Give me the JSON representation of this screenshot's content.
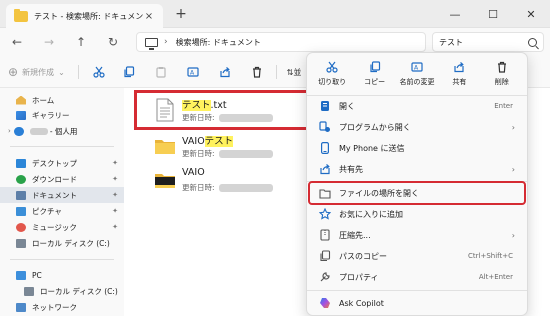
{
  "window": {
    "tab_title": "テスト - 検索場所: ドキュメント",
    "tab_close": "×",
    "new_tab": "+",
    "minimize": "—",
    "maximize": "☐",
    "close": "✕"
  },
  "nav": {
    "back": "←",
    "forward": "→",
    "up": "↑",
    "refresh": "↻",
    "address_chevron": "›",
    "address_text": "検索場所: ドキュメント",
    "search_value": "テスト"
  },
  "toolbar": {
    "new_label": "新規作成",
    "new_chevron": "⌄",
    "sort_partial": "並"
  },
  "sidebar": {
    "items": [
      {
        "label": "ホーム",
        "icon": "home-icon"
      },
      {
        "label": "ギャラリー",
        "icon": "gallery-icon"
      },
      {
        "label": "- 個人用",
        "icon": "onedrive-icon"
      },
      {
        "label": "デスクトップ",
        "icon": "desktop-icon"
      },
      {
        "label": "ダウンロード",
        "icon": "download-icon"
      },
      {
        "label": "ドキュメント",
        "icon": "documents-icon"
      },
      {
        "label": "ピクチャ",
        "icon": "pictures-icon"
      },
      {
        "label": "ミュージック",
        "icon": "music-icon"
      },
      {
        "label": "ローカル ディスク (C:)",
        "icon": "drive-icon"
      },
      {
        "label": "PC",
        "icon": "pc-icon"
      },
      {
        "label": "ローカル ディスク (C:)",
        "icon": "drive-icon"
      },
      {
        "label": "ネットワーク",
        "icon": "network-icon"
      }
    ],
    "pin_glyph": "📌"
  },
  "files": [
    {
      "name_hl": "テスト",
      "name_rest": ".txt",
      "name_pre": "",
      "meta_label": "更新日時:",
      "type": "text-file"
    },
    {
      "name_pre": "VAIO",
      "name_hl": "テスト",
      "name_rest": "",
      "meta_label": "更新日時:",
      "type": "folder"
    },
    {
      "name_pre": "VAIO",
      "name_hl": "",
      "name_rest": "",
      "meta_label": "更新日時:",
      "type": "folder-black"
    }
  ],
  "context_menu": {
    "quick_actions": [
      {
        "label": "切り取り",
        "icon": "cut-icon"
      },
      {
        "label": "コピー",
        "icon": "copy-icon"
      },
      {
        "label": "名前の変更",
        "icon": "rename-icon"
      },
      {
        "label": "共有",
        "icon": "share-icon"
      },
      {
        "label": "削除",
        "icon": "delete-icon"
      }
    ],
    "items": [
      {
        "label": "開く",
        "shortcut": "Enter",
        "arrow": "",
        "icon": "open-icon"
      },
      {
        "label": "プログラムから開く",
        "shortcut": "",
        "arrow": "›",
        "icon": "open-with-icon"
      },
      {
        "label": "My Phone に送信",
        "shortcut": "",
        "arrow": "",
        "icon": "phone-icon"
      },
      {
        "label": "共有先",
        "shortcut": "",
        "arrow": "›",
        "icon": "share-to-icon"
      },
      {
        "label": "ファイルの場所を開く",
        "shortcut": "",
        "arrow": "",
        "icon": "folder-open-icon"
      },
      {
        "label": "お気に入りに追加",
        "shortcut": "",
        "arrow": "",
        "icon": "star-icon"
      },
      {
        "label": "圧縮先...",
        "shortcut": "",
        "arrow": "›",
        "icon": "zip-icon"
      },
      {
        "label": "パスのコピー",
        "shortcut": "Ctrl+Shift+C",
        "arrow": "",
        "icon": "copy-path-icon"
      },
      {
        "label": "プロパティ",
        "shortcut": "Alt+Enter",
        "arrow": "",
        "icon": "wrench-icon"
      },
      {
        "label": "Ask Copilot",
        "shortcut": "",
        "arrow": "",
        "icon": "copilot-icon"
      }
    ]
  },
  "colors": {
    "highlight_box": "#d52b33",
    "search_hit": "#fff25e",
    "accent": "#0067c0"
  }
}
